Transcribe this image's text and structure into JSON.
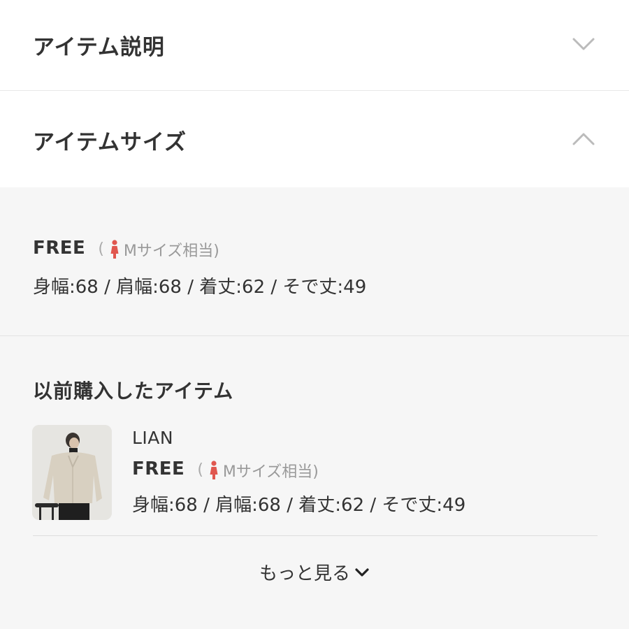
{
  "sections": {
    "item_description": {
      "title": "アイテム説明",
      "expanded": false
    },
    "item_size": {
      "title": "アイテムサイズ",
      "expanded": true
    }
  },
  "size": {
    "name": "FREE",
    "equiv_open": "(",
    "equiv_text": "Mサイズ相当)",
    "measurements": "身幅:68 / 肩幅:68 / 着丈:62 / そで丈:49"
  },
  "previous": {
    "title": "以前購入したアイテム",
    "item": {
      "brand": "LIAN",
      "size_name": "FREE",
      "equiv_open": "(",
      "equiv_text": "Mサイズ相当)",
      "measurements": "身幅:68 / 肩幅:68 / 着丈:62 / そで丈:49"
    },
    "more_label": "もっと見る"
  },
  "colors": {
    "accent_figure": "#e0574f",
    "panel_bg": "#f6f6f6",
    "chevron": "#bbbbbb"
  }
}
